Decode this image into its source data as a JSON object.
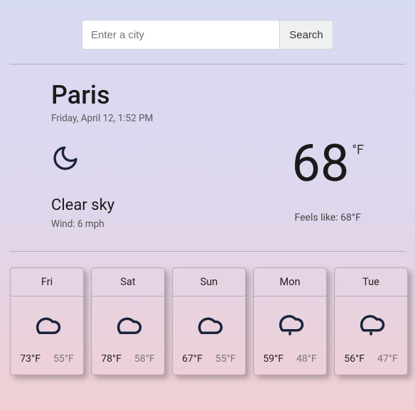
{
  "search": {
    "placeholder": "Enter a city",
    "button": "Search"
  },
  "current": {
    "city": "Paris",
    "datetime": "Friday, April 12, 1:52 PM",
    "icon": "moon-icon",
    "condition": "Clear sky",
    "wind": "Wind: 6 mph",
    "temp": "68",
    "unit": "°F",
    "feels_like": "Feels like: 68°F"
  },
  "forecast": [
    {
      "day": "Fri",
      "icon": "cloud-icon",
      "hi": "73°F",
      "lo": "55°F"
    },
    {
      "day": "Sat",
      "icon": "cloud-icon",
      "hi": "78°F",
      "lo": "58°F"
    },
    {
      "day": "Sun",
      "icon": "cloud-icon",
      "hi": "67°F",
      "lo": "55°F"
    },
    {
      "day": "Mon",
      "icon": "drizzle-icon",
      "hi": "59°F",
      "lo": "48°F"
    },
    {
      "day": "Tue",
      "icon": "drizzle-icon",
      "hi": "56°F",
      "lo": "47°F"
    }
  ]
}
